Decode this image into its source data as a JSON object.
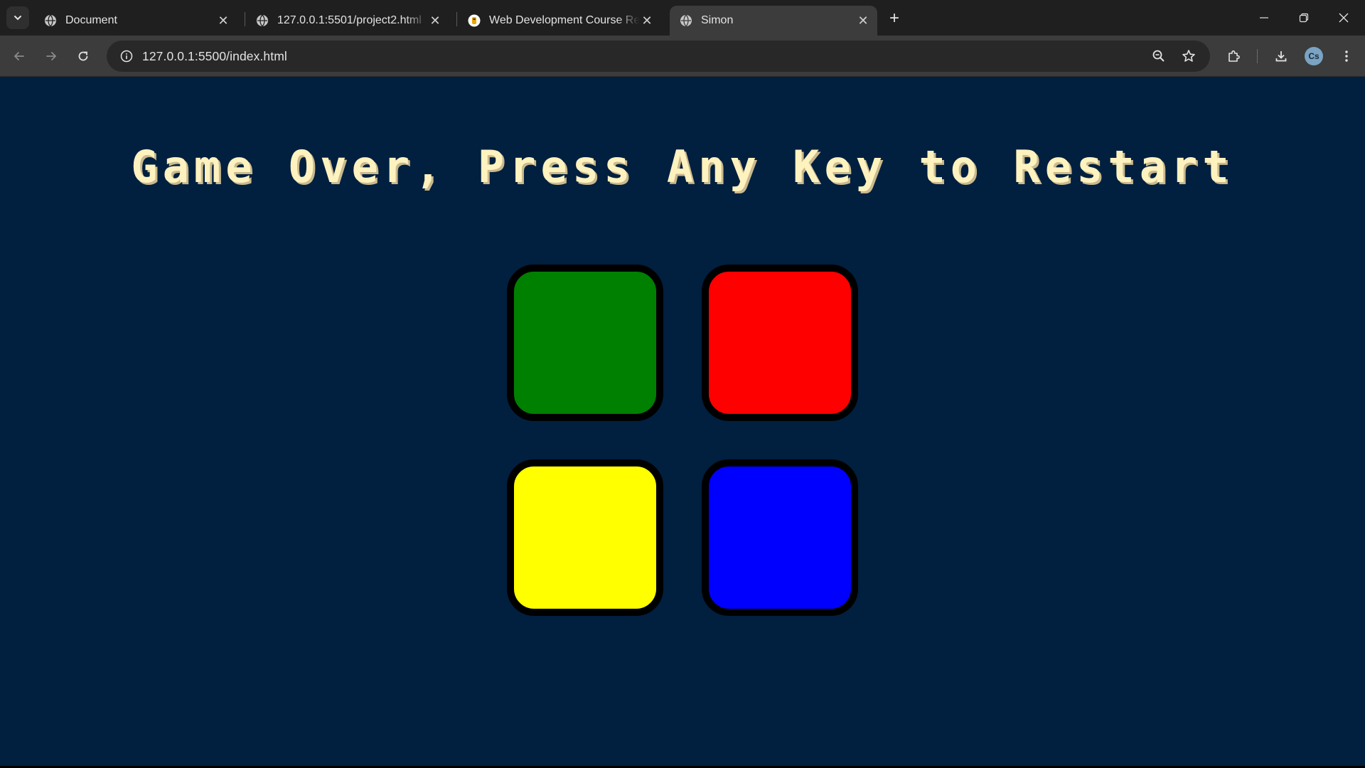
{
  "browser": {
    "tabs": [
      {
        "title": "Document",
        "favicon": "globe-icon",
        "active": false
      },
      {
        "title": "127.0.0.1:5501/project2.html",
        "favicon": "globe-icon",
        "active": false
      },
      {
        "title": "Web Development Course Reso",
        "favicon": "course-logo-icon",
        "active": false
      },
      {
        "title": "Simon",
        "favicon": "globe-icon",
        "active": true
      }
    ],
    "address_bar": {
      "url": "127.0.0.1:5500/index.html"
    },
    "profile_initials": "Cs"
  },
  "game": {
    "level_title": "Game Over, Press Any Key to Restart",
    "buttons": [
      {
        "id": "green",
        "color": "#008000"
      },
      {
        "id": "red",
        "color": "#FF0000"
      },
      {
        "id": "yellow",
        "color": "#FFFF00"
      },
      {
        "id": "blue",
        "color": "#0000FF"
      }
    ],
    "background_color": "#011F3F",
    "title_color": "#FEF2BF"
  }
}
